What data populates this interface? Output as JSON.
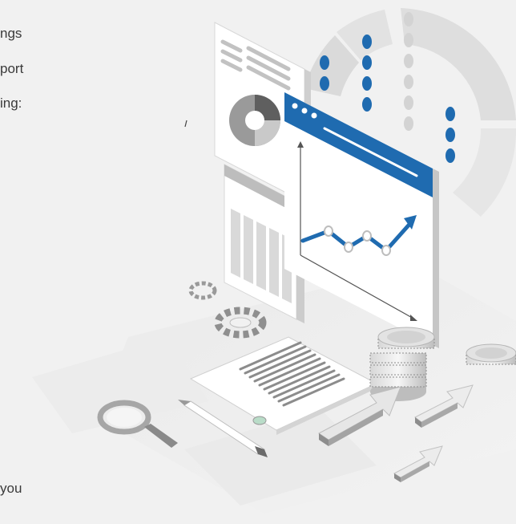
{
  "text_fragments": {
    "line1": "ngs",
    "line2": "port",
    "line3": "ing:",
    "tail": "you"
  },
  "colors": {
    "background": "#f1f1f1",
    "accent_blue": "#1f6bb0",
    "panel_white": "#ffffff",
    "light_gray": "#e4e4e4",
    "mid_gray": "#c9c9c9",
    "dark_gray": "#8c8c8c"
  },
  "illustration": {
    "icons": [
      "donut-chart-icon",
      "line-chart-window-icon",
      "gear-icon",
      "magnifier-icon",
      "pencil-icon",
      "coin-stack-icon",
      "arrow-up-right-icon",
      "document-icon"
    ]
  }
}
